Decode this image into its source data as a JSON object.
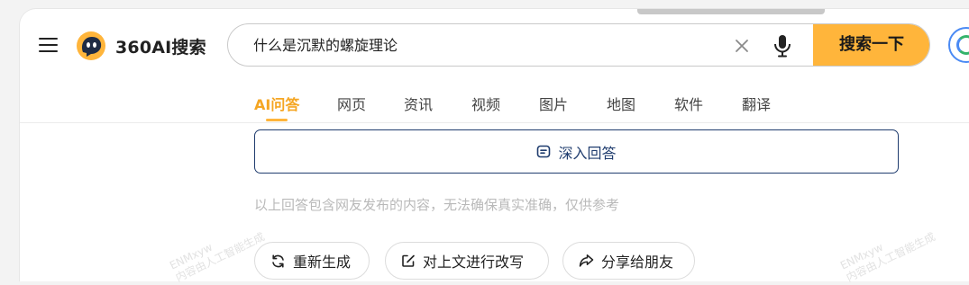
{
  "header": {
    "logo_text": "360AI搜索",
    "search": {
      "query": "什么是沉默的螺旋理论",
      "button_label": "搜索一下"
    }
  },
  "tabs": [
    {
      "label": "AI问答",
      "active": true
    },
    {
      "label": "网页",
      "active": false
    },
    {
      "label": "资讯",
      "active": false
    },
    {
      "label": "视频",
      "active": false
    },
    {
      "label": "图片",
      "active": false
    },
    {
      "label": "地图",
      "active": false
    },
    {
      "label": "软件",
      "active": false
    },
    {
      "label": "翻译",
      "active": false
    }
  ],
  "main": {
    "deep_answer_label": "深入回答",
    "disclaimer": "以上回答包含网友发布的内容，无法确保真实准确，仅供参考",
    "actions": [
      {
        "label": "重新生成",
        "icon": "refresh-icon"
      },
      {
        "label": "对上文进行改写",
        "icon": "edit-icon"
      },
      {
        "label": "分享给朋友",
        "icon": "share-icon"
      }
    ]
  },
  "watermark": {
    "line1": "ENMxyw",
    "line2": "内容由人工智能生成"
  },
  "colors": {
    "accent": "#ffb53b",
    "active_tab": "#f5a623",
    "deep_answer_border": "#1f3c6e",
    "disclaimer": "#b9b9b9"
  }
}
